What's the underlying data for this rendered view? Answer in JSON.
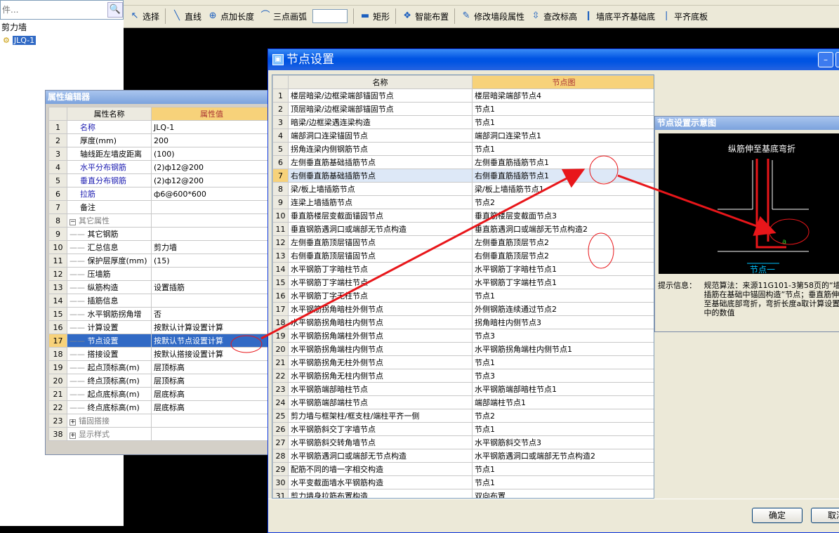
{
  "tree": {
    "search_placeholder": "件...",
    "root_label": "剪力墙",
    "leaf_label": "JLQ-1"
  },
  "toolbar": {
    "items": [
      {
        "label": "选择",
        "icon": "cursor-icon"
      },
      {
        "label": "直线",
        "icon": "line-icon"
      },
      {
        "label": "点加长度",
        "icon": "point-length-icon"
      },
      {
        "label": "三点画弧",
        "icon": "arc-icon"
      },
      {
        "label": "矩形",
        "icon": "rectangle-icon"
      },
      {
        "label": "智能布置",
        "icon": "smart-layout-icon"
      },
      {
        "label": "修改墙段属性",
        "icon": "edit-wall-icon"
      },
      {
        "label": "查改标高",
        "icon": "elevation-icon"
      },
      {
        "label": "墙底平齐基础底",
        "icon": "wall-align-icon"
      },
      {
        "label": "平齐底板",
        "icon": "align-slab-icon"
      }
    ]
  },
  "prop_editor": {
    "title": "属性编辑器",
    "col_name": "属性名称",
    "col_value": "属性值",
    "rows": [
      {
        "n": "1",
        "name": "名称",
        "value": "JLQ-1",
        "style": "blue"
      },
      {
        "n": "2",
        "name": "厚度(mm)",
        "value": "200",
        "style": ""
      },
      {
        "n": "3",
        "name": "轴线距左墙皮距离",
        "value": "(100)",
        "style": ""
      },
      {
        "n": "4",
        "name": "水平分布钢筋",
        "value": "(2)ф12@200",
        "style": "blue"
      },
      {
        "n": "5",
        "name": "垂直分布钢筋",
        "value": "(2)ф12@200",
        "style": "blue"
      },
      {
        "n": "6",
        "name": "拉筋",
        "value": "ф6@600*600",
        "style": "blue"
      },
      {
        "n": "7",
        "name": "备注",
        "value": "",
        "style": ""
      },
      {
        "n": "8",
        "name": "其它属性",
        "value": "",
        "style": "gray",
        "expander": "−"
      },
      {
        "n": "9",
        "name": "其它钢筋",
        "value": "",
        "style": "",
        "indent": true
      },
      {
        "n": "10",
        "name": "汇总信息",
        "value": "剪力墙",
        "style": "",
        "indent": true
      },
      {
        "n": "11",
        "name": "保护层厚度(mm)",
        "value": "(15)",
        "style": "",
        "indent": true
      },
      {
        "n": "12",
        "name": "压墙筋",
        "value": "",
        "style": "",
        "indent": true
      },
      {
        "n": "13",
        "name": "纵筋构造",
        "value": "设置插筋",
        "style": "",
        "indent": true
      },
      {
        "n": "14",
        "name": "插筋信息",
        "value": "",
        "style": "",
        "indent": true
      },
      {
        "n": "15",
        "name": "水平钢筋拐角增",
        "value": "否",
        "style": "",
        "indent": true
      },
      {
        "n": "16",
        "name": "计算设置",
        "value": "按默认计算设置计算",
        "style": "",
        "indent": true
      },
      {
        "n": "17",
        "name": "节点设置",
        "value": "按默认节点设置计算",
        "style": "",
        "indent": true,
        "selected": true
      },
      {
        "n": "18",
        "name": "搭接设置",
        "value": "按默认搭接设置计算",
        "style": "",
        "indent": true
      },
      {
        "n": "19",
        "name": "起点顶标高(m)",
        "value": "层顶标高",
        "style": "",
        "indent": true
      },
      {
        "n": "20",
        "name": "终点顶标高(m)",
        "value": "层顶标高",
        "style": "",
        "indent": true
      },
      {
        "n": "21",
        "name": "起点底标高(m)",
        "value": "层底标高",
        "style": "",
        "indent": true
      },
      {
        "n": "22",
        "name": "终点底标高(m)",
        "value": "层底标高",
        "style": "",
        "indent": true
      },
      {
        "n": "23",
        "name": "锚固搭接",
        "value": "",
        "style": "gray",
        "expander": "+"
      },
      {
        "n": "38",
        "name": "显示样式",
        "value": "",
        "style": "gray",
        "expander": "+"
      }
    ]
  },
  "node_dialog": {
    "title": "节点设置",
    "col_name": "名称",
    "col_image": "节点图",
    "rows": [
      {
        "n": "1",
        "name": "楼层暗梁/边框梁端部锚固节点",
        "node": "楼层暗梁端部节点4"
      },
      {
        "n": "2",
        "name": "顶层暗梁/边框梁端部锚固节点",
        "node": "节点1"
      },
      {
        "n": "3",
        "name": "暗梁/边框梁遇连梁构造",
        "node": "节点1"
      },
      {
        "n": "4",
        "name": "端部洞口连梁锚固节点",
        "node": "端部洞口连梁节点1"
      },
      {
        "n": "5",
        "name": "拐角连梁内侧钢筋节点",
        "node": "节点1"
      },
      {
        "n": "6",
        "name": "左侧垂直筋基础插筋节点",
        "node": "左侧垂直筋插筋节点1"
      },
      {
        "n": "7",
        "name": "右侧垂直筋基础插筋节点",
        "node": "右侧垂直筋插筋节点1",
        "selected": true
      },
      {
        "n": "8",
        "name": "梁/板上墙插筋节点",
        "node": "梁/板上墙插筋节点1"
      },
      {
        "n": "9",
        "name": "连梁上墙插筋节点",
        "node": "节点2"
      },
      {
        "n": "10",
        "name": "垂直筋楼层变截面锚固节点",
        "node": "垂直筋楼层变截面节点3"
      },
      {
        "n": "11",
        "name": "垂直钢筋遇洞口或端部无节点构造",
        "node": "垂直筋遇洞口或端部无节点构造2"
      },
      {
        "n": "12",
        "name": "左侧垂直筋顶层锚固节点",
        "node": "左侧垂直筋顶层节点2"
      },
      {
        "n": "13",
        "name": "右侧垂直筋顶层锚固节点",
        "node": "右侧垂直筋顶层节点2"
      },
      {
        "n": "14",
        "name": "水平钢筋丁字暗柱节点",
        "node": "水平钢筋丁字暗柱节点1"
      },
      {
        "n": "15",
        "name": "水平钢筋丁字端柱节点",
        "node": "水平钢筋丁字端柱节点1"
      },
      {
        "n": "16",
        "name": "水平钢筋丁字无柱节点",
        "node": "节点1"
      },
      {
        "n": "17",
        "name": "水平钢筋拐角暗柱外侧节点",
        "node": "外侧钢筋连续通过节点2"
      },
      {
        "n": "18",
        "name": "水平钢筋拐角暗柱内侧节点",
        "node": "拐角暗柱内侧节点3"
      },
      {
        "n": "19",
        "name": "水平钢筋拐角端柱外侧节点",
        "node": "节点3"
      },
      {
        "n": "20",
        "name": "水平钢筋拐角端柱内侧节点",
        "node": "水平钢筋拐角端柱内侧节点1"
      },
      {
        "n": "21",
        "name": "水平钢筋拐角无柱外侧节点",
        "node": "节点1"
      },
      {
        "n": "22",
        "name": "水平钢筋拐角无柱内侧节点",
        "node": "节点3"
      },
      {
        "n": "23",
        "name": "水平钢筋端部暗柱节点",
        "node": "水平钢筋端部暗柱节点1"
      },
      {
        "n": "24",
        "name": "水平钢筋端部端柱节点",
        "node": "端部端柱节点1"
      },
      {
        "n": "25",
        "name": "剪力墙与框架柱/框支柱/端柱平齐一侧",
        "node": "节点2"
      },
      {
        "n": "26",
        "name": "水平钢筋斜交丁字墙节点",
        "node": "节点1"
      },
      {
        "n": "27",
        "name": "水平钢筋斜交转角墙节点",
        "node": "水平钢筋斜交节点3"
      },
      {
        "n": "28",
        "name": "水平钢筋遇洞口或端部无节点构造",
        "node": "水平钢筋遇洞口或端部无节点构造2"
      },
      {
        "n": "29",
        "name": "配筋不同的墙一字相交构造",
        "node": "节点1"
      },
      {
        "n": "30",
        "name": "水平变截面墙水平钢筋构造",
        "node": "节点1"
      },
      {
        "n": "31",
        "name": "剪力墙身拉筋布置构造",
        "node": "双向布置"
      }
    ],
    "ok_label": "确定",
    "cancel_label": "取消"
  },
  "diagram": {
    "title": "节点设置示意图",
    "caption_top": "纵筋伸至基底弯折",
    "caption_bottom": "节点一",
    "dim_label": "a",
    "hint_label": "提示信息：",
    "hint_text": "规范算法：来源11G101-3第58页的“墙插筋在基础中锚固构造”节点；垂直筋伸至基础底部弯折，弯折长度a取计算设置中的数值"
  },
  "colors": {
    "selection": "#316ac5",
    "header_gold": "#f7d27a",
    "annotation_red": "#e8161a",
    "xp_title_blue": "#0054e3"
  }
}
